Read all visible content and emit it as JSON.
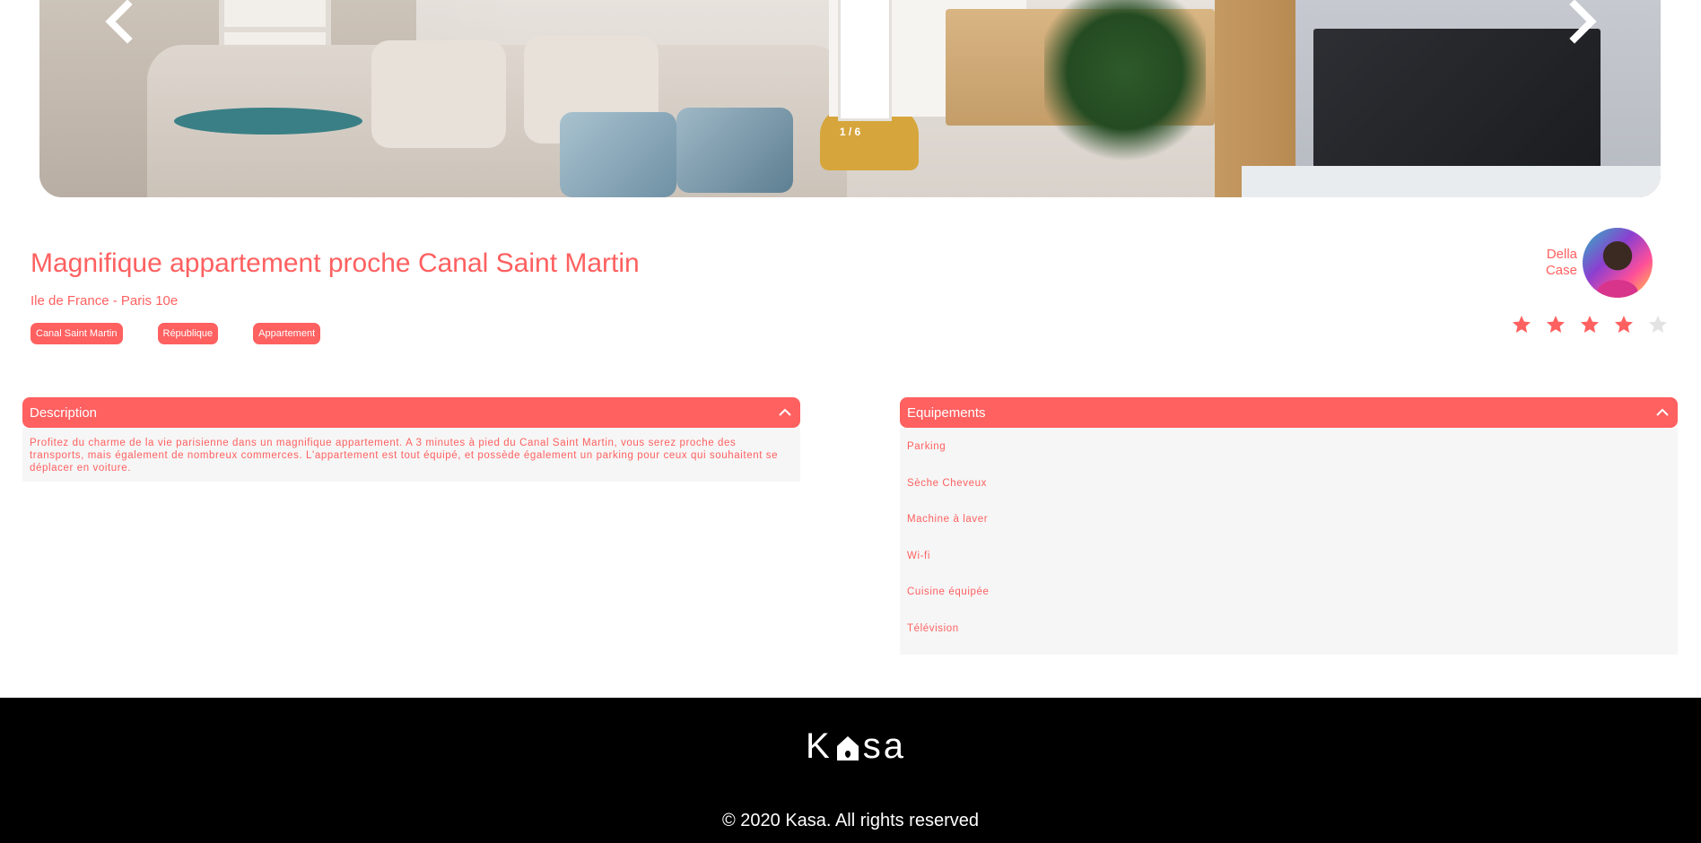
{
  "carousel": {
    "counter": "1 / 6",
    "prev_label": "previous image",
    "next_label": "next image"
  },
  "listing": {
    "title": "Magnifique appartement proche Canal Saint Martin",
    "location": "Ile de France - Paris 10e",
    "tags": [
      "Canal Saint Martin",
      "République",
      "Appartement"
    ],
    "host": {
      "first_name": "Della",
      "last_name": "Case"
    },
    "rating": 4,
    "rating_max": 5
  },
  "description": {
    "header": "Description",
    "text": "Profitez du charme de la vie parisienne dans un magnifique appartement. A 3 minutes à pied du Canal Saint Martin, vous serez proche des transports, mais également de nombreux commerces. L'appartement est tout équipé, et possède également un parking pour ceux qui souhaitent se déplacer en voiture."
  },
  "equipments": {
    "header": "Equipements",
    "items": [
      "Parking",
      "Sèche Cheveux",
      "Machine à laver",
      "Wi-fi",
      "Cuisine équipée",
      "Télévision"
    ]
  },
  "footer": {
    "logo_left": "K",
    "logo_right": "sa",
    "copyright": "© 2020 Kasa. All rights reserved"
  },
  "colors": {
    "accent": "#FF6060",
    "star_inactive": "#E3E3E3",
    "panel_bg": "#F6F6F6",
    "footer_bg": "#000000"
  },
  "icons": {
    "prev": "chevron-left-icon",
    "next": "chevron-right-icon",
    "collapse": "chevron-up-icon",
    "star": "star-icon"
  }
}
